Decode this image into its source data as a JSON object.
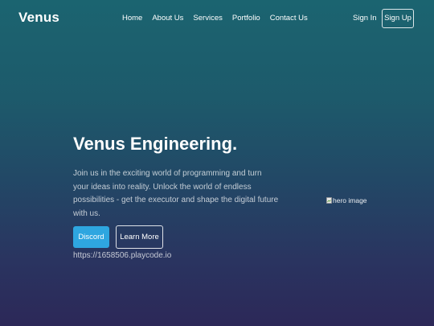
{
  "header": {
    "logo": "Venus",
    "nav": [
      {
        "label": "Home"
      },
      {
        "label": "About Us"
      },
      {
        "label": "Services"
      },
      {
        "label": "Portfolio"
      },
      {
        "label": "Contact Us"
      }
    ],
    "sign_in_label": "Sign In",
    "sign_up_label": "Sign Up"
  },
  "hero": {
    "title": "Venus Engineering.",
    "description": "Join us in the exciting world of programming and turn your ideas into reality. Unlock the world of endless possibilities - get the executor and shape the digital future with us.",
    "discord_label": "Discord",
    "learn_more_label": "Learn More",
    "link_text": "https://1658506.playcode.io",
    "image_alt": "hero image",
    "image_icon": "broken-image-icon"
  },
  "colors": {
    "background_top": "#1b6470",
    "background_bottom": "#2c2858",
    "accent_button": "#2ea6e0",
    "text": "#ffffff"
  }
}
